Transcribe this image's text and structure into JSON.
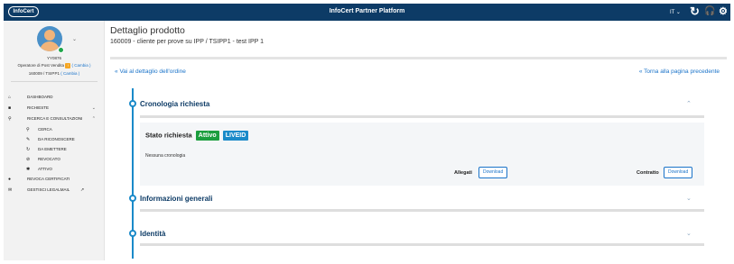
{
  "header": {
    "logo_text": "InfoCert",
    "title": "InfoCert Partner Platform",
    "language": "IT",
    "icons": [
      "refresh-icon",
      "support-icon",
      "settings-icon"
    ]
  },
  "sidebar": {
    "user_id": "YY0876",
    "role": "Operatore di Post Vendita",
    "role_warning": "!",
    "role_action": "( Cambia )",
    "point": "160009 / TSIPP1",
    "point_action": "( Cambia )",
    "items": [
      {
        "label": "DASHBOARD",
        "icon": "home-icon"
      },
      {
        "label": "RICHIESTE",
        "icon": "briefcase-icon"
      },
      {
        "label": "RICERCA E CONSULTAZIONI",
        "icon": "search-icon"
      },
      {
        "label": "CERCA",
        "icon": "search-icon"
      },
      {
        "label": "DA RICONOSCERE",
        "icon": "pen-icon"
      },
      {
        "label": "DA EMETTERE",
        "icon": "refresh-icon"
      },
      {
        "label": "REVOCATO",
        "icon": "ban-icon"
      },
      {
        "label": "ATTIVO",
        "icon": "star-icon"
      },
      {
        "label": "REVOCA CERTIFICATI",
        "icon": "circle-icon"
      },
      {
        "label": "GESTISCI LEGALMAIL",
        "icon": "mail-icon"
      }
    ]
  },
  "page": {
    "title": "Dettaglio prodotto",
    "subtitle": "160009 - cliente per prove su IPP  / TSIPP1 - test IPP 1",
    "back_order": "Vai al dettaglio dell'ordine",
    "back_prev": "Torna alla pagina precedente",
    "back_glyph": "«"
  },
  "sections": {
    "cronologia": {
      "title": "Cronologia richiesta",
      "status_label": "Stato richiesta",
      "badge_active": "Attivo",
      "badge_liveid": "LIVEID",
      "empty_text": "Nessuna cronologia",
      "allegati_label": "Allegati",
      "contratto_label": "Contratto",
      "download_label": "Download"
    },
    "informazioni": {
      "title": "Informazioni generali"
    },
    "identita": {
      "title": "Identità"
    }
  },
  "colors": {
    "header_bg": "#0d3b66",
    "accent": "#1a8ac9",
    "link": "#1a73c9",
    "badge_active": "#1b9e3e"
  }
}
